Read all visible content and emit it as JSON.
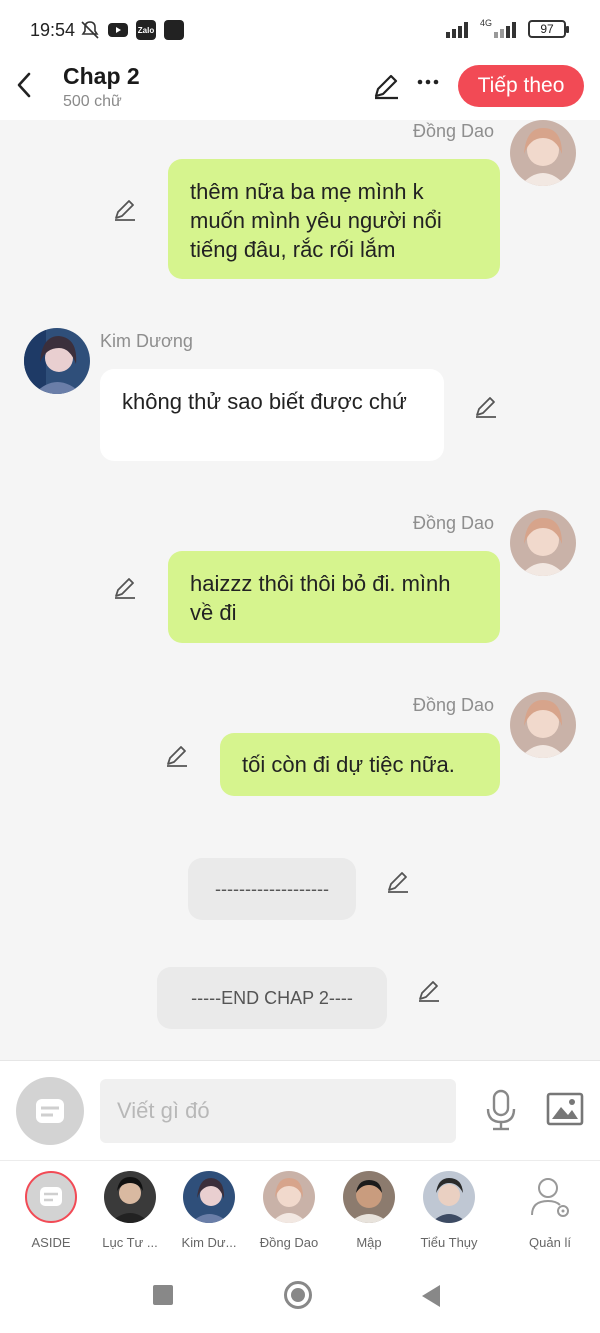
{
  "status_bar": {
    "time": "19:54",
    "left_icons": [
      "bell-off-icon",
      "youtube-icon",
      "zalo-icon",
      "app-icon"
    ],
    "zalo_text": "Zalo",
    "network": "4G",
    "battery": "97"
  },
  "header": {
    "title": "Chap 2",
    "subtitle": "500 chữ",
    "next_label": "Tiếp theo"
  },
  "colors": {
    "accent": "#f24a55",
    "my_bubble": "#d6f48e",
    "other_bubble": "#ffffff"
  },
  "messages": [
    {
      "sender": "Đồng Dao",
      "text": "thêm nữa ba mẹ mình k muốn mình yêu người nổi tiếng đâu, rắc rối lắm",
      "side": "right"
    },
    {
      "sender": "Kim Dương",
      "text": "không thử sao biết được chứ",
      "side": "left"
    },
    {
      "sender": "Đồng Dao",
      "text": "haizzz thôi thôi bỏ đi. mình về đi",
      "side": "right"
    },
    {
      "sender": "Đồng Dao",
      "text": "tối còn đi dự tiệc nữa.",
      "side": "right"
    },
    {
      "sender": "",
      "text": "-------------------",
      "side": "center"
    },
    {
      "sender": "",
      "text": "-----END CHAP 2----",
      "side": "center"
    }
  ],
  "composer": {
    "placeholder": "Viết gì đó"
  },
  "characters": [
    {
      "label": "ASIDE"
    },
    {
      "label": "Lục Tư ..."
    },
    {
      "label": "Kim Dư..."
    },
    {
      "label": "Đồng Dao"
    },
    {
      "label": "Mập"
    },
    {
      "label": "Tiểu Thụy"
    },
    {
      "label": "Quản lí"
    }
  ]
}
